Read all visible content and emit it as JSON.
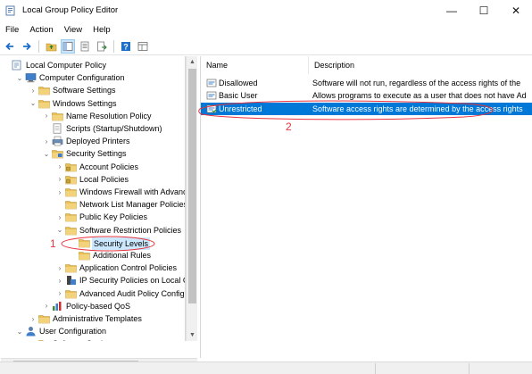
{
  "window": {
    "title": "Local Group Policy Editor",
    "icon": "policy-editor-icon",
    "controls": {
      "minimize": "—",
      "maximize": "☐",
      "close": "✕"
    }
  },
  "menu": [
    "File",
    "Action",
    "View",
    "Help"
  ],
  "toolbar": {
    "buttons": [
      "back-arrow-icon",
      "forward-arrow-icon",
      "up-folder-icon",
      "show-hide-tree-icon",
      "properties-icon",
      "export-list-icon",
      "help-icon",
      "extended-view-icon"
    ]
  },
  "tree": {
    "items": [
      {
        "label": "Local Computer Policy",
        "icon": "computer-policy-icon",
        "expander": "",
        "level": 0
      },
      {
        "label": "Computer Configuration",
        "icon": "computer-icon",
        "expander": "⌄",
        "level": 1
      },
      {
        "label": "Software Settings",
        "icon": "folder-icon",
        "expander": "›",
        "level": 2
      },
      {
        "label": "Windows Settings",
        "icon": "folder-icon",
        "expander": "⌄",
        "level": 2
      },
      {
        "label": "Name Resolution Policy",
        "icon": "folder-icon",
        "expander": "›",
        "level": 3
      },
      {
        "label": "Scripts (Startup/Shutdown)",
        "icon": "script-icon",
        "expander": "",
        "level": 3
      },
      {
        "label": "Deployed Printers",
        "icon": "printer-icon",
        "expander": "›",
        "level": 3
      },
      {
        "label": "Security Settings",
        "icon": "security-settings-icon",
        "expander": "⌄",
        "level": 3
      },
      {
        "label": "Account Policies",
        "icon": "folder-lock-icon",
        "expander": "›",
        "level": 4
      },
      {
        "label": "Local Policies",
        "icon": "folder-lock-icon",
        "expander": "›",
        "level": 4
      },
      {
        "label": "Windows Firewall with Advanc",
        "icon": "folder-icon",
        "expander": "›",
        "level": 4
      },
      {
        "label": "Network List Manager Policies",
        "icon": "folder-icon",
        "expander": "",
        "level": 4
      },
      {
        "label": "Public Key Policies",
        "icon": "folder-icon",
        "expander": "›",
        "level": 4
      },
      {
        "label": "Software Restriction Policies",
        "icon": "folder-icon",
        "expander": "⌄",
        "level": 4
      },
      {
        "label": "Security Levels",
        "icon": "folder-icon",
        "expander": "",
        "level": 5
      },
      {
        "label": "Additional Rules",
        "icon": "folder-icon",
        "expander": "",
        "level": 5
      },
      {
        "label": "Application Control Policies",
        "icon": "folder-icon",
        "expander": "›",
        "level": 4
      },
      {
        "label": "IP Security Policies on Local Co",
        "icon": "ip-security-icon",
        "expander": "›",
        "level": 4
      },
      {
        "label": "Advanced Audit Policy Config",
        "icon": "folder-icon",
        "expander": "›",
        "level": 4
      },
      {
        "label": "Policy-based QoS",
        "icon": "qos-chart-icon",
        "expander": "›",
        "level": 3
      },
      {
        "label": "Administrative Templates",
        "icon": "folder-icon",
        "expander": "›",
        "level": 2
      },
      {
        "label": "User Configuration",
        "icon": "user-icon",
        "expander": "⌄",
        "level": 1
      },
      {
        "label": "Software Settings",
        "icon": "folder-icon",
        "expander": "›",
        "level": 2
      }
    ],
    "selected_index": 14
  },
  "list": {
    "columns": {
      "name": "Name",
      "description": "Description"
    },
    "rows": [
      {
        "name": "Disallowed",
        "description": "Software will not run, regardless of the access rights of the",
        "icon": "security-level-icon"
      },
      {
        "name": "Basic User",
        "description": "Allows programs to execute as a user that does not have Ad",
        "icon": "security-level-icon"
      },
      {
        "name": "Unrestricted",
        "description": "Software access rights are determined by the access rights",
        "icon": "security-level-default-icon"
      }
    ],
    "selected_index": 2
  },
  "annotations": [
    {
      "label": "1",
      "color": "#e8323c"
    },
    {
      "label": "2",
      "color": "#e8323c"
    }
  ],
  "colors": {
    "selection_blue": "#0078d7",
    "tree_selection": "#cce8ff",
    "folder": "#e8c055",
    "annotation_red": "#e8323c"
  }
}
